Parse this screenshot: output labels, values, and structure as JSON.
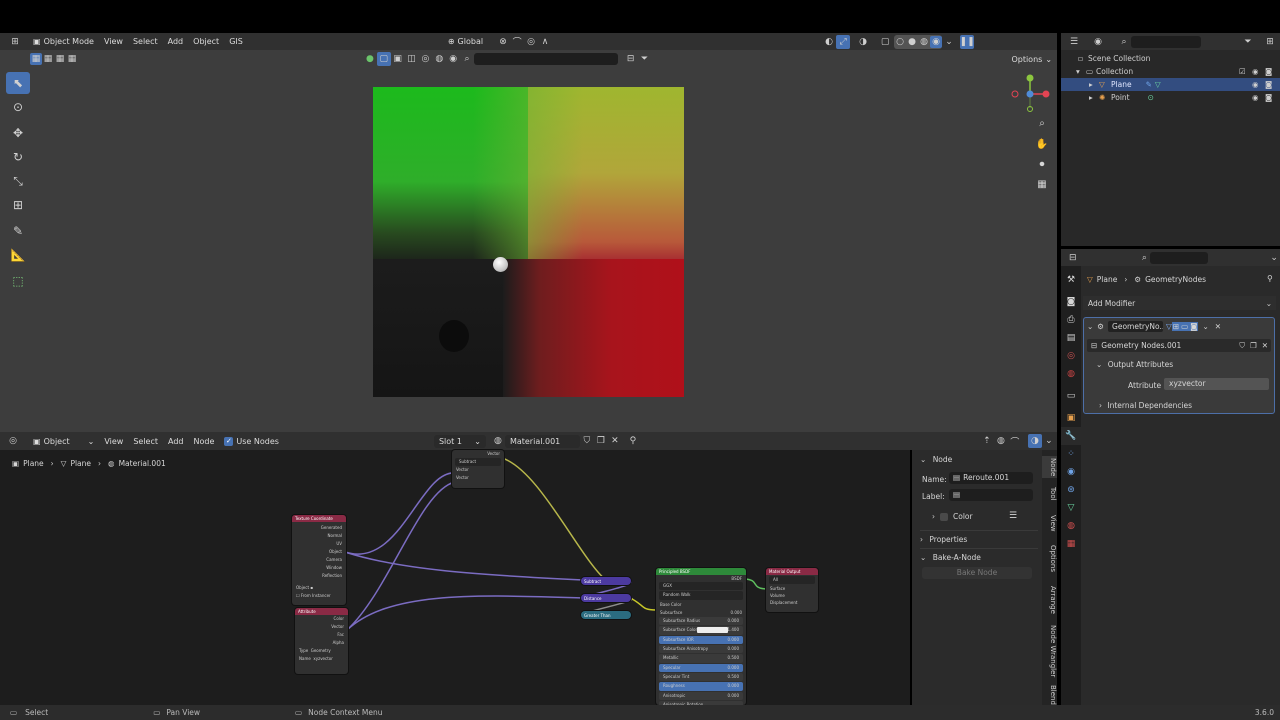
{
  "top_header": {
    "mode": "Object Mode",
    "menu": [
      "View",
      "Select",
      "Add",
      "Object",
      "GIS"
    ],
    "transform_orientation": "Global",
    "options": "Options"
  },
  "viewport": {},
  "outliner": {
    "rows": [
      {
        "label": "Scene Collection"
      },
      {
        "label": "Collection"
      },
      {
        "label": "Plane"
      },
      {
        "label": "Point"
      }
    ]
  },
  "properties": {
    "breadcrumb_object": "Plane",
    "breadcrumb_modifier": "GeometryNodes",
    "add_modifier": "Add Modifier",
    "modifier_name": "GeometryNo...",
    "node_group": "Geometry Nodes.001",
    "output_attributes": "Output Attributes",
    "attribute_label": "Attribute",
    "attribute_value": "xyzvector",
    "internal_dependencies": "Internal Dependencies"
  },
  "node_header": {
    "editor_type": "Object",
    "menu": [
      "View",
      "Select",
      "Add",
      "Node"
    ],
    "use_nodes": "Use Nodes",
    "slot": "Slot 1",
    "material": "Material.001"
  },
  "breadcrumbs": [
    "Plane",
    "Plane",
    "Material.001"
  ],
  "npanel": {
    "section_node": "Node",
    "name_label": "Name:",
    "name_value": "Reroute.001",
    "label_label": "Label:",
    "color": "Color",
    "properties": "Properties",
    "bake_section": "Bake-A-Node",
    "bake_button": "Bake Node",
    "tabs": [
      "Node",
      "Tool",
      "View",
      "Options",
      "Arrange",
      "Node Wrangler",
      "Blend"
    ]
  },
  "nodes": {
    "tex_coord": {
      "title": "Texture Coordinate",
      "outputs": [
        "Generated",
        "Normal",
        "UV",
        "Object",
        "Camera",
        "Window",
        "Reflection"
      ],
      "object": "Object",
      "from_instancer": "From Instancer"
    },
    "attribute": {
      "title": "Attribute",
      "outputs": [
        "Color",
        "Vector",
        "Fac",
        "Alpha"
      ],
      "type_label": "Type",
      "type_value": "Geometry",
      "name_label": "Name",
      "name_value": "xyzvector"
    },
    "subtract_top": {
      "title": "Vector",
      "op": "Subtract",
      "inputs": [
        "Vector",
        "Vector"
      ]
    },
    "subtract": {
      "title": "Subtract"
    },
    "distance": {
      "title": "Distance"
    },
    "greater_than": {
      "title": "Greater Than"
    },
    "principled": {
      "title": "Principled BSDF",
      "out": "BSDF",
      "rows": [
        "GGX",
        "Random Walk",
        "Base Color",
        "Subsurface",
        "Subsurface Radius",
        "Subsurface Color",
        "Subsurface IOR",
        "Subsurface Anisotropy",
        "Metallic",
        "Specular",
        "Specular Tint",
        "Roughness",
        "Anisotropic",
        "Anisotropic Rotation"
      ],
      "values": [
        "0.000",
        "1.400",
        "0.000",
        "0.000",
        "0.500",
        "0.000",
        "0.500",
        "0.000",
        "0.000"
      ]
    },
    "material_output": {
      "title": "Material Output",
      "target": "All",
      "inputs": [
        "Surface",
        "Volume",
        "Displacement"
      ]
    }
  },
  "statusbar": {
    "select": "Select",
    "pan": "Pan View",
    "context": "Node Context Menu",
    "version": "3.6.0"
  },
  "colors": {
    "accent": "#4772b3",
    "header": "#303030",
    "viewport_bg": "#3d3d3d",
    "node_bg": "#1d1d1d"
  }
}
